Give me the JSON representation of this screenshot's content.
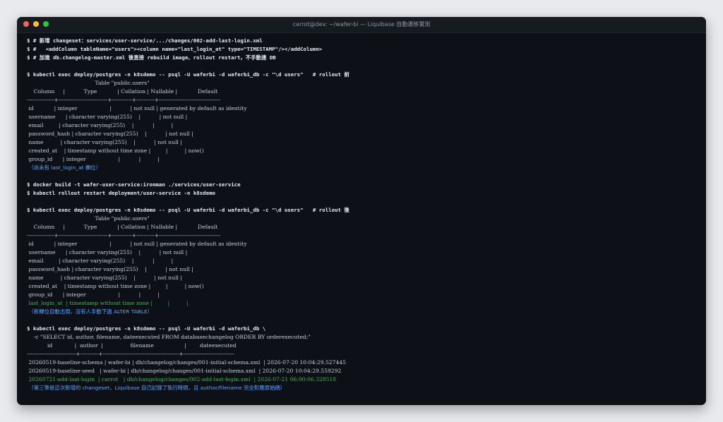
{
  "window": {
    "title": "carrot@dev: ~/wafer-bi — Liquibase 自動遷移實測"
  },
  "terminal": {
    "lines": [
      {
        "type": "cmd",
        "text": "$ # 新增 changeset：services/user-service/.../changes/002-add-last-login.xml"
      },
      {
        "type": "cmd",
        "text": "$ #   <addColumn tableName=\"users\"><column name=\"last_login_at\" type=\"TIMESTAMP\"/></addColumn>"
      },
      {
        "type": "cmd",
        "text": "$ # 加進 db.changelog-master.xml 後直接 rebuild image、rollout restart，不手動連 DB"
      },
      {
        "type": "blank",
        "text": ""
      },
      {
        "type": "cmd",
        "text": "$ kubectl exec deploy/postgres -n k8sdemo -- psql -U waferbi -d waferbi_db -c \"\\d users\"   # rollout 前"
      },
      {
        "type": "out",
        "text": "                                        Table \"public.users\""
      },
      {
        "type": "out",
        "text": "    Column     |           Type            | Collation | Nullable |            Default"
      },
      {
        "type": "out",
        "text": "---------------+---------------------------+-----------+----------+----------------------------------"
      },
      {
        "type": "out",
        "text": " id            | integer                   |           | not null | generated by default as identity"
      },
      {
        "type": "out",
        "text": " username      | character varying(255)    |           | not null |"
      },
      {
        "type": "out",
        "text": " email         | character varying(255)    |           |          |"
      },
      {
        "type": "out",
        "text": " password_hash | character varying(255)    |           | not null |"
      },
      {
        "type": "out",
        "text": " name          | character varying(255)    |           | not null |"
      },
      {
        "type": "out",
        "text": " created_at    | timestamp without time zone |         |          | now()"
      },
      {
        "type": "out",
        "text": " group_id      | integer                   |           |          |"
      },
      {
        "type": "note",
        "text": " （尚未有 last_login_at 欄位）"
      },
      {
        "type": "blank",
        "text": ""
      },
      {
        "type": "cmd",
        "text": "$ docker build -t wafer-user-service:ironman ./services/user-service"
      },
      {
        "type": "cmd",
        "text": "$ kubectl rollout restart deployment/user-service -n k8sdemo"
      },
      {
        "type": "blank",
        "text": ""
      },
      {
        "type": "cmd",
        "text": "$ kubectl exec deploy/postgres -n k8sdemo -- psql -U waferbi -d waferbi_db -c \"\\d users\"   # rollout 後"
      },
      {
        "type": "out",
        "text": "                                        Table \"public.users\""
      },
      {
        "type": "out",
        "text": "    Column     |           Type            | Collation | Nullable |            Default"
      },
      {
        "type": "out",
        "text": "---------------+---------------------------+-----------+----------+----------------------------------"
      },
      {
        "type": "out",
        "text": " id            | integer                   |           | not null | generated by default as identity"
      },
      {
        "type": "out",
        "text": " username      | character varying(255)    |           | not null |"
      },
      {
        "type": "out",
        "text": " email         | character varying(255)    |           |          |"
      },
      {
        "type": "out",
        "text": " password_hash | character varying(255)    |           | not null |"
      },
      {
        "type": "out",
        "text": " name          | character varying(255)    |           | not null |"
      },
      {
        "type": "out",
        "text": " created_at    | timestamp without time zone |         |          | now()"
      },
      {
        "type": "out",
        "text": " group_id      | integer                   |           |          |"
      },
      {
        "type": "new",
        "text": " last_login_at  | timestamp without time zone |         |          |"
      },
      {
        "type": "note",
        "text": " （新欄位自動出現，沒有人手動下過 ALTER TABLE）"
      },
      {
        "type": "blank",
        "text": ""
      },
      {
        "type": "cmd",
        "text": "$ kubectl exec deploy/postgres -n k8sdemo -- psql -U waferbi -d waferbi_db \\"
      },
      {
        "type": "out",
        "text": "    -c \"SELECT id, author, filename, dateexecuted FROM databasechangelog ORDER BY orderexecuted;\""
      },
      {
        "type": "out",
        "text": "            id             |  author  |                filename                  |        dateexecuted"
      },
      {
        "type": "out",
        "text": "---------------------------+----------+------------------------------------------+----------------------------"
      },
      {
        "type": "out",
        "text": " 20260519-baseline-schema | wafer-bi | db/changelog/changes/001-initial-schema.xml  | 2026-07-20 10:04:29.527445"
      },
      {
        "type": "out",
        "text": " 20260519-baseline-seed   | wafer-bi | db/changelog/changes/001-initial-schema.xml  | 2026-07-20 10:04:29.559292"
      },
      {
        "type": "new",
        "text": " 20260721-add-last-login  | carrot   | db/changelog/changes/002-add-last-login.xml  | 2026-07-21 06:00:06.328518"
      },
      {
        "type": "note",
        "text": " （第三筆是這次新增的 changeset，Liquibase 自己記錄了執行時間，且 author/filename 完全對應原始碼）"
      }
    ]
  }
}
